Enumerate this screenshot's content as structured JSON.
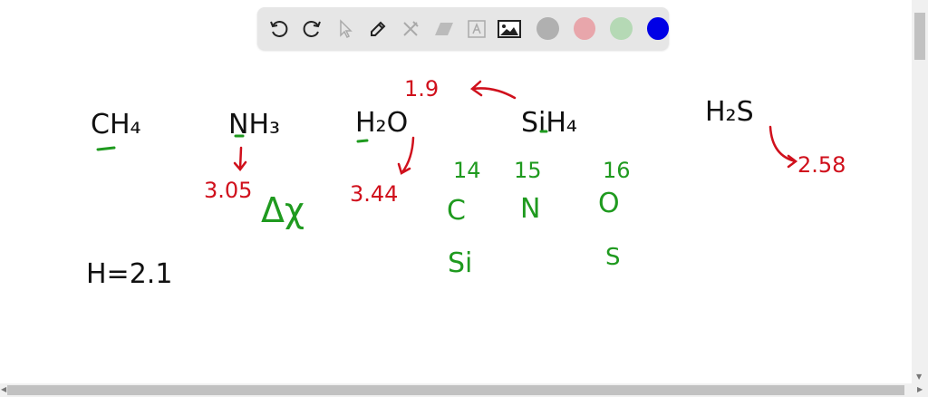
{
  "toolbar": {
    "tools": [
      "undo-icon",
      "redo-icon",
      "select-icon",
      "pen-icon",
      "tools-icon",
      "eraser-icon",
      "text-icon",
      "image-icon"
    ],
    "colors": [
      "#b0b0b0",
      "#e8a6ab",
      "#b5d9b5",
      "#0000e6"
    ]
  },
  "ink_colors": {
    "black": "#111111",
    "red": "#d0101c",
    "green": "#1f9a1f"
  },
  "board": {
    "molecules": {
      "ch4": "CH₄",
      "nh3": "NH₃",
      "h2o": "H₂O",
      "sih4": "SiH₄",
      "h2s": "H₂S"
    },
    "values": {
      "si_en": "1.9",
      "n_en": "3.05",
      "o_en": "3.44",
      "s_en": "2.58",
      "h_en": "H=2.1"
    },
    "delta_chi": "Δχ",
    "groups": [
      "14",
      "15",
      "16"
    ],
    "elements_row1": [
      "C",
      "N",
      "O"
    ],
    "elements_row2": [
      "Si",
      "S"
    ]
  }
}
